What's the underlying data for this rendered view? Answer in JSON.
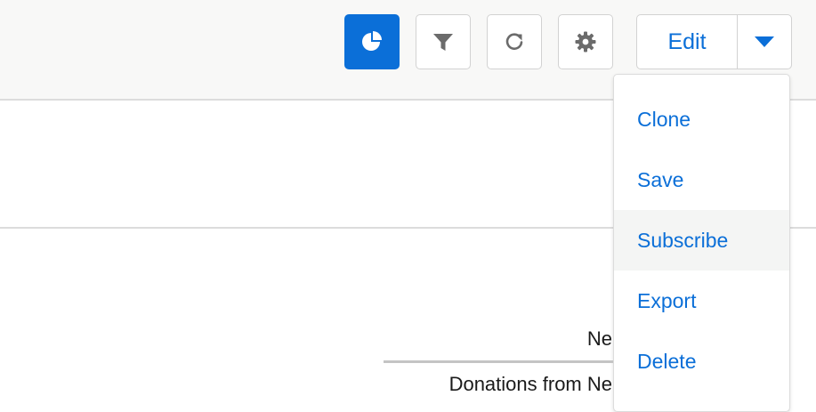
{
  "toolbar": {
    "chart_icon": "pie-chart-icon",
    "filter_icon": "filter-icon",
    "refresh_icon": "refresh-icon",
    "settings_icon": "gear-icon",
    "edit_label": "Edit",
    "menu_toggle_icon": "caret-down-icon",
    "accent_color": "#0b6fd8"
  },
  "menu": {
    "items": [
      {
        "label": "Clone"
      },
      {
        "label": "Save"
      },
      {
        "label": "Subscribe"
      },
      {
        "label": "Export"
      },
      {
        "label": "Delete"
      }
    ]
  },
  "report": {
    "title": "Ne",
    "subtitle": "Donations from Ne"
  }
}
